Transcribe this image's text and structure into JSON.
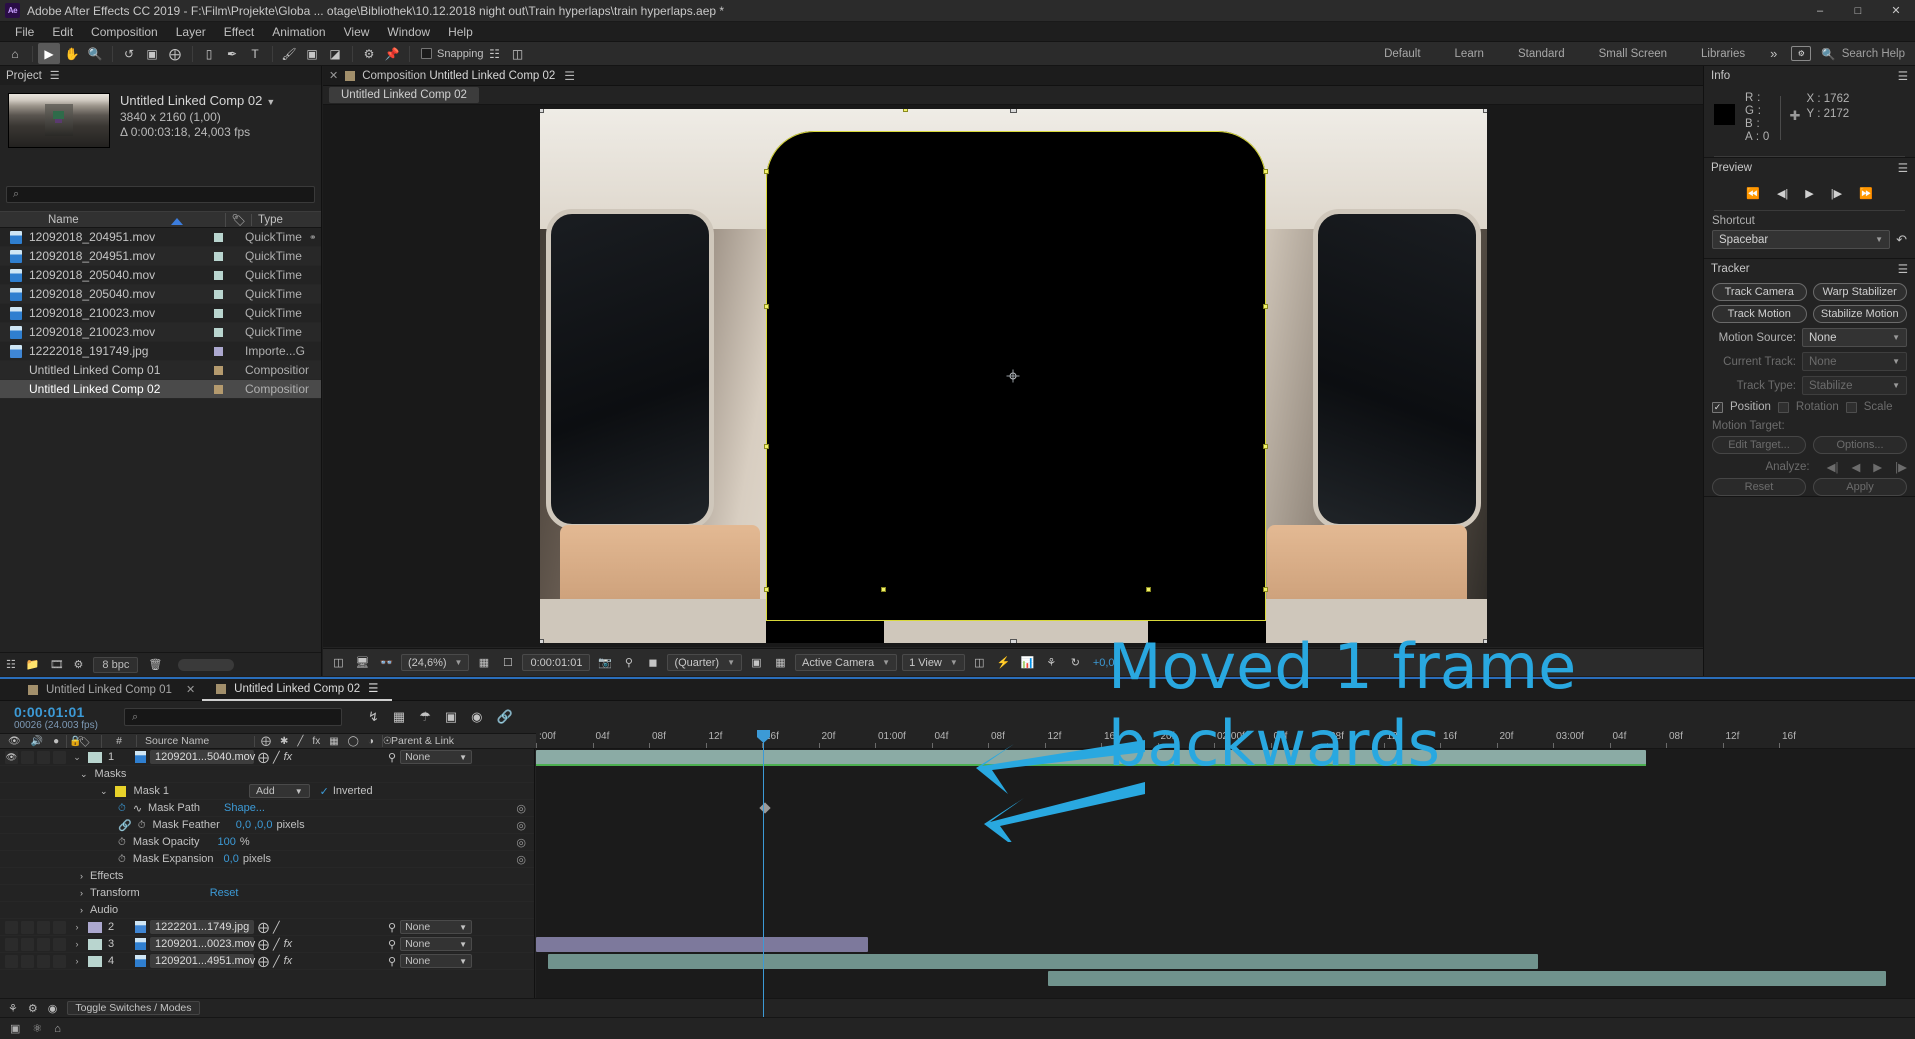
{
  "window": {
    "title": "Adobe After Effects CC 2019 - F:\\Film\\Projekte\\Globa ... otage\\Bibliothek\\10.12.2018 night out\\Train hyperlaps\\train hyperlaps.aep *",
    "logo": "Ae",
    "minimize": "–",
    "maximize": "□",
    "close": "✕"
  },
  "menubar": [
    "File",
    "Edit",
    "Composition",
    "Layer",
    "Effect",
    "Animation",
    "View",
    "Window",
    "Help"
  ],
  "toolbar": {
    "tools": [
      "home-icon",
      "selection-icon",
      "hand-icon",
      "zoom-icon",
      "rotate-icon",
      "camera-icon",
      "anchor-icon",
      "rect-icon",
      "pen-icon",
      "text-icon",
      "brush-icon",
      "clone-icon",
      "eraser-icon",
      "roto-icon",
      "puppet-icon"
    ],
    "snapping_label": "Snapping",
    "workspaces": [
      "Default",
      "Learn",
      "Standard",
      "Small Screen",
      "Libraries"
    ],
    "more": "»",
    "search_help": "Search Help"
  },
  "project": {
    "title": "Project",
    "comp_name": "Untitled Linked Comp 02",
    "comp_res": "3840 x 2160 (1,00)",
    "comp_dur": "Δ 0:00:03:18, 24,003 fps",
    "search_placeholder": "",
    "columns": [
      "Name",
      "Type"
    ],
    "items": [
      {
        "name": "12092018_204951.mov",
        "type": "QuickTime",
        "color": "#b9d5cf",
        "icon": "mov",
        "shared": true
      },
      {
        "name": "12092018_204951.mov",
        "type": "QuickTime",
        "color": "#b9d5cf",
        "icon": "mov",
        "shared": false
      },
      {
        "name": "12092018_205040.mov",
        "type": "QuickTime",
        "color": "#b9d5cf",
        "icon": "mov",
        "shared": false
      },
      {
        "name": "12092018_205040.mov",
        "type": "QuickTime",
        "color": "#b9d5cf",
        "icon": "mov",
        "shared": false
      },
      {
        "name": "12092018_210023.mov",
        "type": "QuickTime",
        "color": "#b9d5cf",
        "icon": "mov",
        "shared": false
      },
      {
        "name": "12092018_210023.mov",
        "type": "QuickTime",
        "color": "#b9d5cf",
        "icon": "mov",
        "shared": false
      },
      {
        "name": "12222018_191749.jpg",
        "type": "Importe...G",
        "color": "#aca8cf",
        "icon": "jpg",
        "shared": false
      },
      {
        "name": "Untitled Linked Comp 01",
        "type": "Composition",
        "color": "#b49a6e",
        "icon": "comp",
        "shared": false
      },
      {
        "name": "Untitled Linked Comp 02",
        "type": "Composition",
        "color": "#b49a6e",
        "icon": "comp",
        "shared": false,
        "selected": true
      }
    ],
    "footer": {
      "bpc": "8 bpc"
    }
  },
  "composition": {
    "tab_prefix": "Composition",
    "tab_name": "Untitled Linked Comp 02",
    "subtab": "Untitled Linked Comp 02",
    "viewer_bar": {
      "zoom": "(24,6%)",
      "time": "0:00:01:01",
      "resolution": "(Quarter)",
      "view_mode": "Active Camera",
      "views": "1 View",
      "offset": "+0,0"
    }
  },
  "info": {
    "title": "Info",
    "r": "R :",
    "g": "G :",
    "b": "B :",
    "a": "A : 0",
    "x": "X : 1762",
    "y": "Y : 2172"
  },
  "preview": {
    "title": "Preview",
    "buttons": [
      "first-frame-icon",
      "prev-frame-icon",
      "play-icon",
      "next-frame-icon",
      "last-frame-icon"
    ],
    "shortcut_label": "Shortcut",
    "shortcut_value": "Spacebar"
  },
  "tracker": {
    "title": "Tracker",
    "track_camera": "Track Camera",
    "warp_stabilizer": "Warp Stabilizer",
    "track_motion": "Track Motion",
    "stabilize_motion": "Stabilize Motion",
    "motion_source_label": "Motion Source:",
    "motion_source_value": "None",
    "current_track_label": "Current Track:",
    "current_track_value": "None",
    "track_type_label": "Track Type:",
    "track_type_value": "Stabilize",
    "position": "Position",
    "rotation": "Rotation",
    "scale": "Scale",
    "motion_target_label": "Motion Target:",
    "edit_target": "Edit Target...",
    "options": "Options...",
    "analyze_label": "Analyze:",
    "reset": "Reset",
    "apply": "Apply"
  },
  "timeline": {
    "tabs": [
      {
        "label": "Untitled Linked Comp 01",
        "active": false
      },
      {
        "label": "Untitled Linked Comp 02",
        "active": true
      }
    ],
    "current_time": "0:00:01:01",
    "frame_info": "00026 (24.003 fps)",
    "search_placeholder": "",
    "columns": {
      "num": "#",
      "source": "Source Name",
      "parent": "Parent & Link"
    },
    "layers": [
      {
        "num": "1",
        "name": "1209201...5040.mov",
        "color": "#b9d5cf",
        "icon": "mov",
        "parent": "None",
        "expanded": true
      },
      {
        "num": "2",
        "name": "1222201...1749.jpg",
        "color": "#aca8cf",
        "icon": "jpg",
        "parent": "None",
        "expanded": false
      },
      {
        "num": "3",
        "name": "1209201...0023.mov",
        "color": "#b9d5cf",
        "icon": "mov",
        "parent": "None",
        "expanded": false
      },
      {
        "num": "4",
        "name": "1209201...4951.mov",
        "color": "#b9d5cf",
        "icon": "mov",
        "parent": "None",
        "expanded": false
      }
    ],
    "masks_group": "Masks",
    "mask": {
      "name": "Mask 1",
      "mode": "Add",
      "inverted": "Inverted",
      "color": "#e8d22a",
      "properties": [
        {
          "label": "Mask Path",
          "value": "Shape...",
          "unit": "",
          "animated": true
        },
        {
          "label": "Mask Feather",
          "value": "0,0 ,0,0",
          "unit": "pixels",
          "animated": false
        },
        {
          "label": "Mask Opacity",
          "value": "100",
          "unit": "%",
          "animated": false
        },
        {
          "label": "Mask Expansion",
          "value": "0,0",
          "unit": "pixels",
          "animated": false
        }
      ]
    },
    "groups": [
      {
        "label": "Effects",
        "value": ""
      },
      {
        "label": "Transform",
        "value": "Reset"
      },
      {
        "label": "Audio",
        "value": ""
      }
    ],
    "ruler_ticks": [
      ":00f",
      "04f",
      "08f",
      "12f",
      "16f",
      "20f",
      "01:00f",
      "04f",
      "08f",
      "12f",
      "16f",
      "20f",
      "02:00f",
      "04f",
      "08f",
      "12f",
      "16f",
      "20f",
      "03:00f",
      "04f",
      "08f",
      "12f",
      "16f"
    ],
    "toggle_switches": "Toggle Switches / Modes"
  },
  "annotation": {
    "line1": "Moved 1 frame",
    "line2": "backwards",
    "color": "#29a8e0"
  }
}
